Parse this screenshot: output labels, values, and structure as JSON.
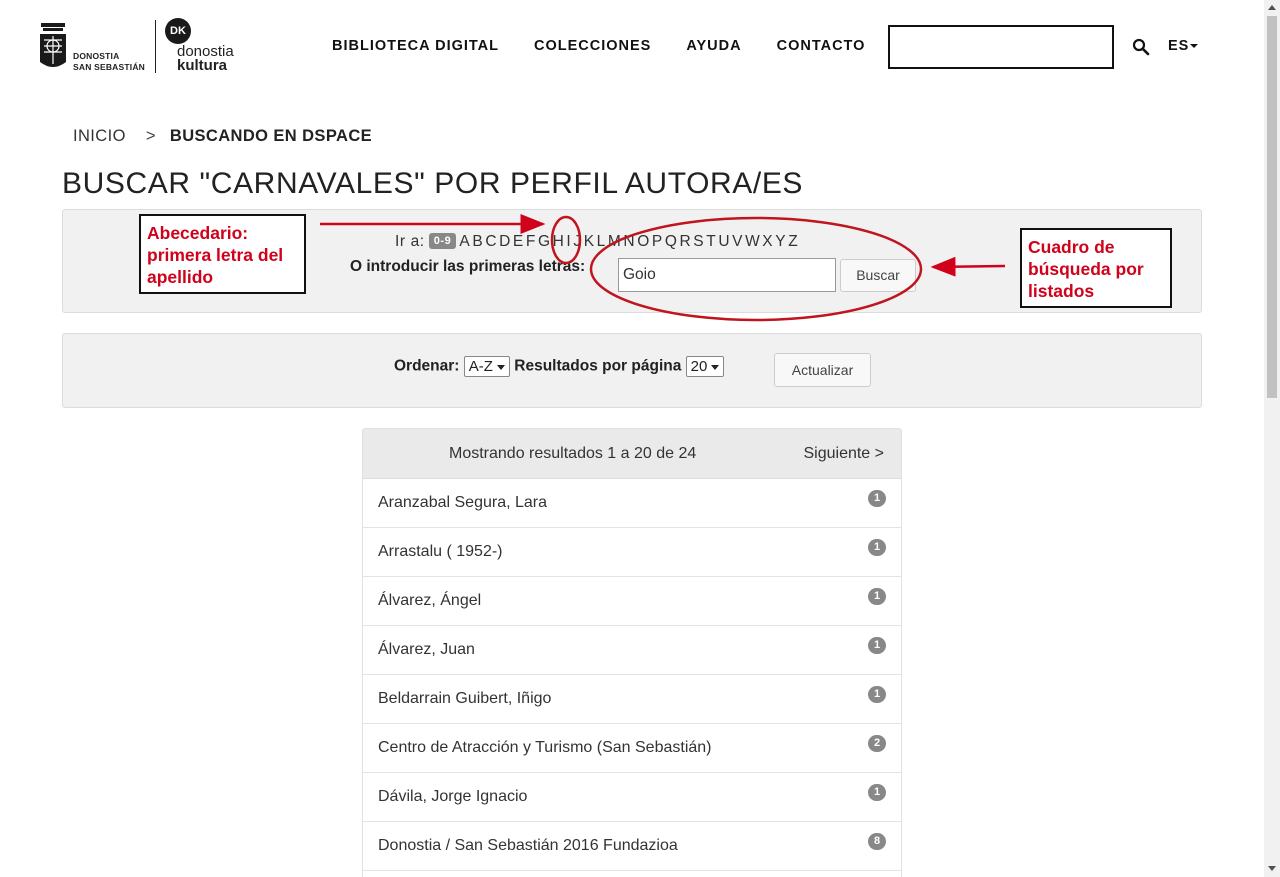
{
  "header": {
    "logo_ss_line1": "DONOSTIA",
    "logo_ss_line2": "SAN SEBASTIÁN",
    "logo_dk_mark": "DK",
    "logo_dk_line1": "donostia",
    "logo_dk_line2": "kultura",
    "nav": [
      "BIBLIOTECA DIGITAL",
      "COLECCIONES",
      "AYUDA",
      "CONTACTO"
    ],
    "search_value": "",
    "lang": "ES"
  },
  "breadcrumb": {
    "home": "INICIO",
    "separator": ">",
    "current": "BUSCANDO EN DSPACE"
  },
  "page_title": "BUSCAR \"CARNAVALES\" POR PERFIL AUTORA/ES",
  "browse": {
    "jump_label": "Ir a:",
    "digits_label": "0-9",
    "letters": [
      "A",
      "B",
      "C",
      "D",
      "E",
      "F",
      "G",
      "H",
      "I",
      "J",
      "K",
      "L",
      "M",
      "N",
      "O",
      "P",
      "Q",
      "R",
      "S",
      "T",
      "U",
      "V",
      "W",
      "X",
      "Y",
      "Z"
    ],
    "starts_with_label": "O introducir las primeras letras:",
    "starts_with_value": "Goio",
    "search_button": "Buscar"
  },
  "sort": {
    "order_label": "Ordenar:",
    "order_value": "A-Z",
    "rpp_label": "Resultados por página",
    "rpp_value": "20",
    "update_button": "Actualizar"
  },
  "results": {
    "info": "Mostrando resultados 1 a 20 de 24",
    "next": "Siguiente >",
    "items": [
      {
        "name": "Aranzabal Segura, Lara",
        "count": "1"
      },
      {
        "name": "Arrastalu ( 1952-)",
        "count": "1"
      },
      {
        "name": "Álvarez, Ángel",
        "count": "1"
      },
      {
        "name": "Álvarez, Juan",
        "count": "1"
      },
      {
        "name": "Beldarrain Guibert, Iñigo",
        "count": "1"
      },
      {
        "name": "Centro de Atracción y Turismo (San Sebastián)",
        "count": "2"
      },
      {
        "name": "Dávila, Jorge Ignacio",
        "count": "1"
      },
      {
        "name": "Donostia / San Sebastián 2016 Fundazioa",
        "count": "8"
      }
    ]
  },
  "annotations": {
    "abecedario": [
      "Abecedario:",
      "primera letra del",
      "apellido"
    ],
    "cuadro": [
      "Cuadro de",
      "búsqueda por",
      "listados"
    ],
    "color": "#d0021b"
  }
}
